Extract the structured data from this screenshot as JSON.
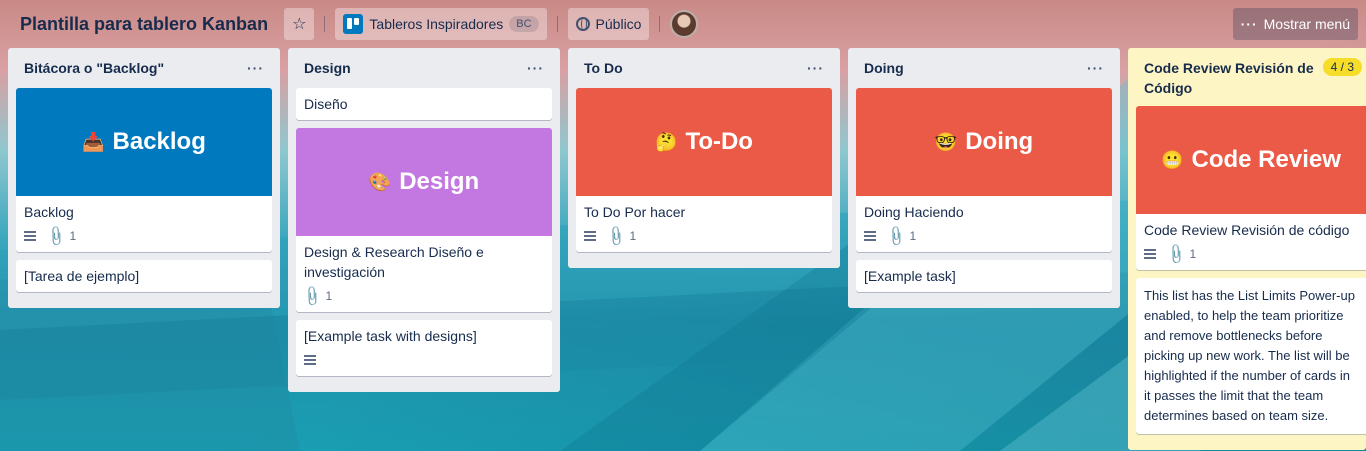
{
  "board": {
    "title": "Plantilla para tablero Kanban",
    "workspace": "Tableros Inspiradores",
    "workspace_badge": "BC",
    "visibility": "Público",
    "menu_label": "Mostrar menú",
    "menu_dots": "···"
  },
  "lists": [
    {
      "title": "Bitácora o \"Backlog\"",
      "more": "···",
      "cards": [
        {
          "cover_text": "Backlog",
          "cover_emoji": "📥",
          "cover_color": "#0079bf",
          "title": "Backlog",
          "has_description": true,
          "attachments": "1"
        },
        {
          "title": "[Tarea de ejemplo]"
        }
      ]
    },
    {
      "title": "Design",
      "more": "···",
      "cards": [
        {
          "title": "Diseño"
        },
        {
          "cover_text": "Design",
          "cover_emoji": "🎨",
          "cover_color": "#c377e0",
          "title": "Design & Research Diseño e investigación",
          "attachments": "1"
        },
        {
          "title": "[Example task with designs]",
          "has_description": true
        }
      ]
    },
    {
      "title": "To Do",
      "more": "···",
      "cards": [
        {
          "cover_text": "To-Do",
          "cover_emoji": "🤔",
          "cover_color": "#eb5a46",
          "title": "To Do Por hacer",
          "has_description": true,
          "attachments": "1"
        }
      ]
    },
    {
      "title": "Doing",
      "more": "···",
      "cards": [
        {
          "cover_text": "Doing",
          "cover_emoji": "🤓",
          "cover_color": "#eb5a46",
          "title": "Doing Haciendo",
          "has_description": true,
          "attachments": "1"
        },
        {
          "title": "[Example task]"
        }
      ]
    },
    {
      "title": "Code Review Revisión de Código",
      "limit": "4 / 3",
      "cards": [
        {
          "cover_text": "Code Review",
          "cover_emoji": "😬",
          "cover_color": "#eb5a46",
          "title": "Code Review Revisión de código",
          "has_description": true,
          "attachments": "1"
        },
        {
          "text": "This list has the List Limits Power-up enabled, to help the team prioritize and remove bottlenecks before picking up new work. The list will be highlighted if the number of cards in it passes the limit that the team determines based on team size."
        }
      ]
    }
  ]
}
